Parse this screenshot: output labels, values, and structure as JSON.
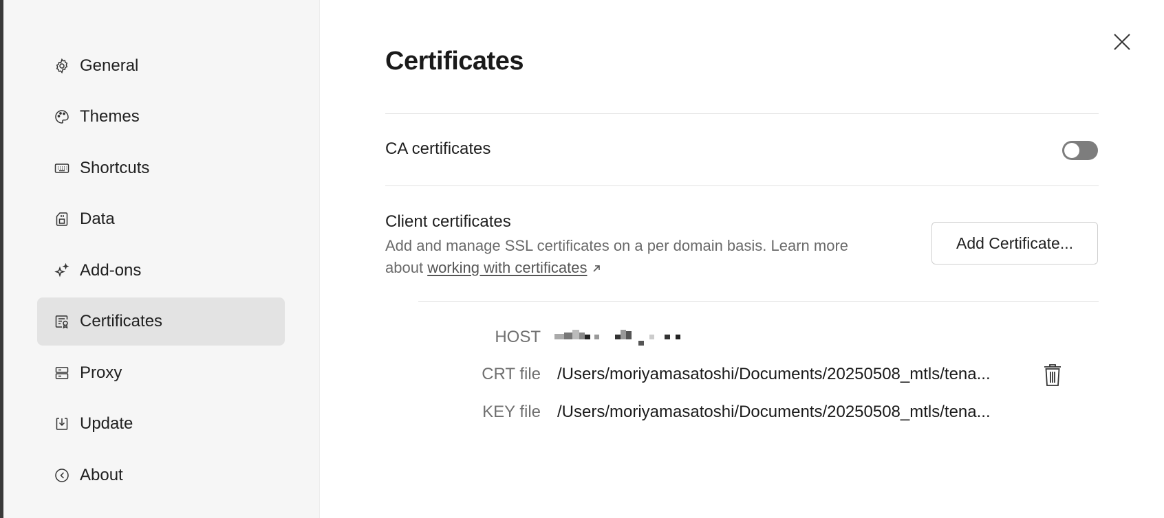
{
  "sidebar": {
    "items": [
      {
        "label": "General",
        "icon": "gear-icon"
      },
      {
        "label": "Themes",
        "icon": "palette-icon"
      },
      {
        "label": "Shortcuts",
        "icon": "keyboard-icon"
      },
      {
        "label": "Data",
        "icon": "sd-card-icon"
      },
      {
        "label": "Add-ons",
        "icon": "sparkles-icon"
      },
      {
        "label": "Certificates",
        "icon": "certificate-icon",
        "active": true
      },
      {
        "label": "Proxy",
        "icon": "server-icon"
      },
      {
        "label": "Update",
        "icon": "download-icon"
      },
      {
        "label": "About",
        "icon": "about-icon"
      }
    ]
  },
  "main": {
    "title": "Certificates",
    "ca": {
      "label": "CA certificates",
      "enabled": false
    },
    "client": {
      "title": "Client certificates",
      "description": "Add and manage SSL certificates on a per domain basis. Learn more about",
      "link_text": "working with certificates",
      "add_button": "Add Certificate..."
    },
    "certificate": {
      "host_label": "HOST",
      "crt_label": "CRT file",
      "crt_value": "/Users/moriyamasatoshi/Documents/20250508_mtls/tena...",
      "key_label": "KEY file",
      "key_value": "/Users/moriyamasatoshi/Documents/20250508_mtls/tena..."
    }
  },
  "colors": {
    "sidebar_bg": "#f6f6f6",
    "active_item_bg": "#e3e3e3",
    "toggle_off": "#7d7d7d"
  }
}
